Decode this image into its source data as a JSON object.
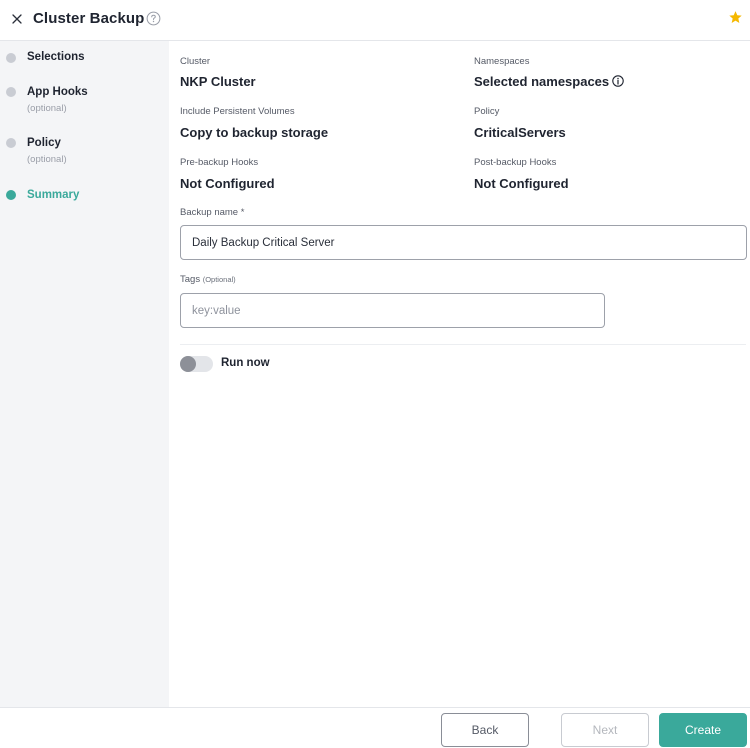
{
  "header": {
    "title": "Cluster Backup",
    "close_icon": "close-icon",
    "help_icon": "help-circle-icon",
    "star_icon": "star-icon",
    "star_color": "#f5b800"
  },
  "sidebar": {
    "steps": [
      {
        "label": "Selections",
        "sub": "",
        "state": "done"
      },
      {
        "label": "App Hooks",
        "sub": "(optional)",
        "state": "done"
      },
      {
        "label": "Policy",
        "sub": "(optional)",
        "state": "done"
      },
      {
        "label": "Summary",
        "sub": "",
        "state": "active"
      }
    ]
  },
  "summary": {
    "cluster": {
      "label": "Cluster",
      "value": "NKP Cluster"
    },
    "namespaces": {
      "label": "Namespaces",
      "value": "Selected namespaces"
    },
    "persistent_volumes": {
      "label": "Include Persistent Volumes",
      "value": "Copy to backup storage"
    },
    "policy": {
      "label": "Policy",
      "value": "CriticalServers"
    },
    "pre_hooks": {
      "label": "Pre-backup Hooks",
      "value": "Not Configured"
    },
    "post_hooks": {
      "label": "Post-backup Hooks",
      "value": "Not Configured"
    }
  },
  "form": {
    "backup_name": {
      "label": "Backup name *",
      "value": "Daily Backup Critical Server"
    },
    "tags": {
      "label": "Tags",
      "optional": "(Optional)",
      "value": "",
      "placeholder": "key:value"
    },
    "run_now": {
      "label": "Run now",
      "enabled": false
    }
  },
  "footer": {
    "back_label": "Back",
    "next_label": "Next",
    "create_label": "Create"
  },
  "colors": {
    "accent": "#3aa99b",
    "sidebar_bg": "#f4f5f7",
    "step_inactive": "#c9ccd3"
  }
}
